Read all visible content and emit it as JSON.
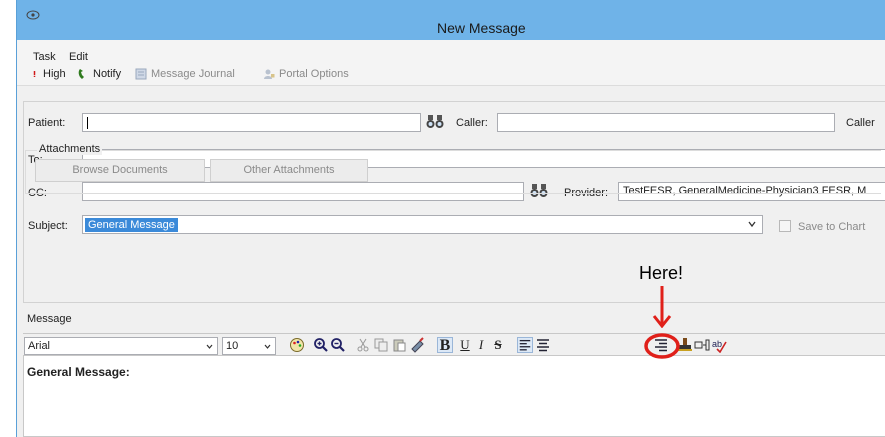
{
  "window": {
    "title": "New Message"
  },
  "menu": {
    "items": [
      "Task",
      "Edit"
    ]
  },
  "toolbar": {
    "high": "High",
    "notify": "Notify",
    "message_journal": "Message Journal",
    "portal_options": "Portal Options"
  },
  "form": {
    "patient_label": "Patient:",
    "patient_value": "",
    "caller_label": "Caller:",
    "caller_value": "",
    "caller_label_2": "Caller",
    "to_label": "To:",
    "to_value": "",
    "cc_label": "CC:",
    "cc_value": "",
    "provider_label": "Provider:",
    "provider_value": "TestFESR, GeneralMedicine-Physician3 FESR, M",
    "subject_label": "Subject:",
    "subject_value": "General Message",
    "save_to_chart": "Save to Chart",
    "attachments_title": "Attachments",
    "browse_documents": "Browse Documents",
    "other_attachments": "Other Attachments"
  },
  "message": {
    "label": "Message",
    "font": "Arial",
    "size": "10",
    "body": "General Message:"
  },
  "annotation": {
    "text": "Here!"
  },
  "colors": {
    "titlebar": "#6fb3e8",
    "selection": "#3b8ad9",
    "annotation_red": "#e0201a"
  }
}
